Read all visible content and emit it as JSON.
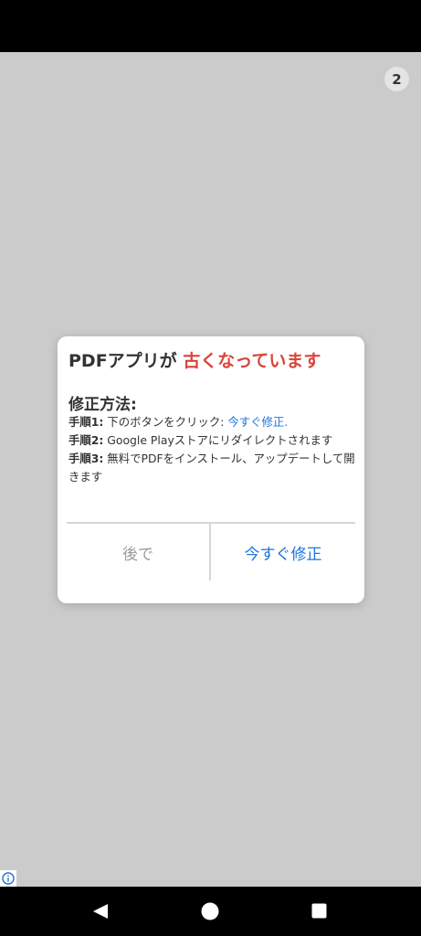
{
  "counter": "2",
  "dialog": {
    "title_prefix": "PDFアプリが ",
    "title_highlight": "古くなっています",
    "section_title": "修正方法:",
    "steps": [
      {
        "label": "手順1:",
        "text": " 下のボタンをクリック: ",
        "link": "今すぐ修正."
      },
      {
        "label": "手順2:",
        "text": " Google Playストアにリダイレクトされます"
      },
      {
        "label": "手順3:",
        "text": " 無料でPDFをインストール、アップデートして開きます"
      }
    ],
    "later_label": "後で",
    "fix_label": "今すぐ修正"
  },
  "colors": {
    "background": "#cbcbcb",
    "title_highlight": "#d9443a",
    "link_blue": "#1e73d8"
  },
  "icons": {
    "ad": "info-icon",
    "nav_back": "back-triangle-icon",
    "nav_home": "home-circle-icon",
    "nav_recents": "recents-square-icon"
  }
}
